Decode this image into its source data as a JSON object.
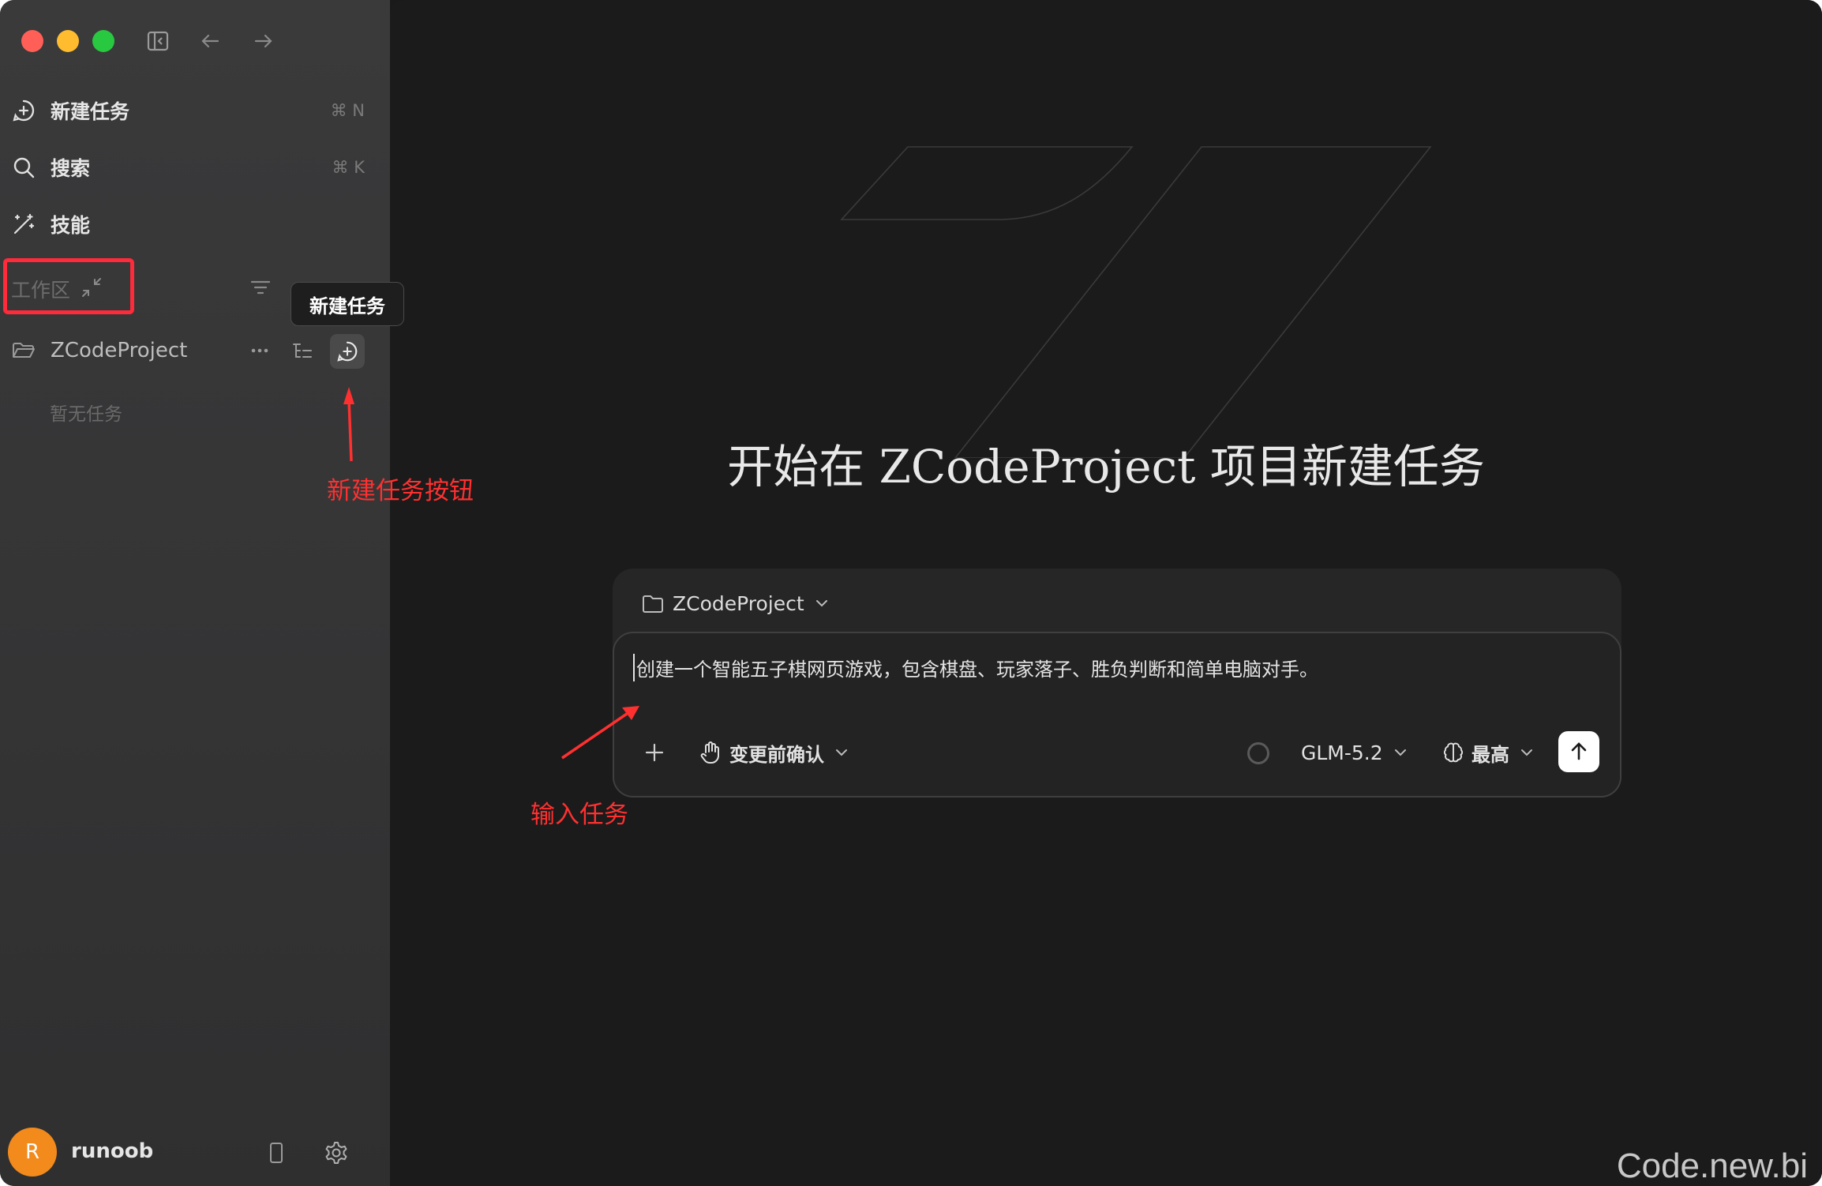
{
  "sidebar": {
    "new_task": {
      "label": "新建任务",
      "shortcut": "⌘ N"
    },
    "search": {
      "label": "搜索",
      "shortcut": "⌘ K"
    },
    "skills": {
      "label": "技能"
    },
    "workspace_label": "工作区",
    "project_name": "ZCodeProject",
    "empty_tasks": "暂无任务",
    "tooltip": "新建任务",
    "user": {
      "avatar_letter": "R",
      "name": "runoob"
    }
  },
  "annotations": {
    "new_task_button": "新建任务按钮",
    "input_task": "输入任务"
  },
  "main": {
    "hero_title": "开始在 ZCodeProject 项目新建任务",
    "composer": {
      "project": "ZCodeProject",
      "input_value": "创建一个智能五子棋网页游戏，包含棋盘、玩家落子、胜负判断和简单电脑对手。",
      "confirm_mode": "变更前确认",
      "model": "GLM-5.2",
      "effort": "最高"
    }
  },
  "watermark": "Code.new.bi",
  "colors": {
    "annotation_red": "#ff3030",
    "avatar_orange": "#f28a1c",
    "traffic_red": "#ff5f57",
    "traffic_yellow": "#febc2e",
    "traffic_green": "#28c840"
  },
  "icons": [
    "sidebar-toggle-icon",
    "arrow-left-icon",
    "arrow-right-icon",
    "new-task-icon",
    "search-icon",
    "magic-wand-icon",
    "collapse-icon",
    "filter-icon",
    "folder-icon",
    "more-icon",
    "list-tree-icon",
    "plus-icon",
    "hand-icon",
    "chevron-down-icon",
    "brain-icon",
    "arrow-up-icon",
    "phone-icon",
    "gear-icon"
  ]
}
